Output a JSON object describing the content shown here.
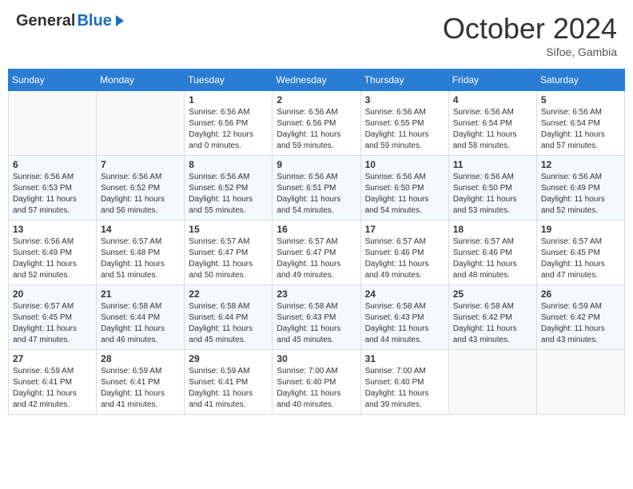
{
  "header": {
    "logo_general": "General",
    "logo_blue": "Blue",
    "month_title": "October 2024",
    "location": "Sifoe, Gambia"
  },
  "weekdays": [
    "Sunday",
    "Monday",
    "Tuesday",
    "Wednesday",
    "Thursday",
    "Friday",
    "Saturday"
  ],
  "weeks": [
    [
      {
        "day": "",
        "info": ""
      },
      {
        "day": "",
        "info": ""
      },
      {
        "day": "1",
        "sunrise": "6:56 AM",
        "sunset": "6:56 PM",
        "daylight": "12 hours and 0 minutes."
      },
      {
        "day": "2",
        "sunrise": "6:56 AM",
        "sunset": "6:56 PM",
        "daylight": "11 hours and 59 minutes."
      },
      {
        "day": "3",
        "sunrise": "6:56 AM",
        "sunset": "6:55 PM",
        "daylight": "11 hours and 59 minutes."
      },
      {
        "day": "4",
        "sunrise": "6:56 AM",
        "sunset": "6:54 PM",
        "daylight": "11 hours and 58 minutes."
      },
      {
        "day": "5",
        "sunrise": "6:56 AM",
        "sunset": "6:54 PM",
        "daylight": "11 hours and 57 minutes."
      }
    ],
    [
      {
        "day": "6",
        "sunrise": "6:56 AM",
        "sunset": "6:53 PM",
        "daylight": "11 hours and 57 minutes."
      },
      {
        "day": "7",
        "sunrise": "6:56 AM",
        "sunset": "6:52 PM",
        "daylight": "11 hours and 56 minutes."
      },
      {
        "day": "8",
        "sunrise": "6:56 AM",
        "sunset": "6:52 PM",
        "daylight": "11 hours and 55 minutes."
      },
      {
        "day": "9",
        "sunrise": "6:56 AM",
        "sunset": "6:51 PM",
        "daylight": "11 hours and 54 minutes."
      },
      {
        "day": "10",
        "sunrise": "6:56 AM",
        "sunset": "6:50 PM",
        "daylight": "11 hours and 54 minutes."
      },
      {
        "day": "11",
        "sunrise": "6:56 AM",
        "sunset": "6:50 PM",
        "daylight": "11 hours and 53 minutes."
      },
      {
        "day": "12",
        "sunrise": "6:56 AM",
        "sunset": "6:49 PM",
        "daylight": "11 hours and 52 minutes."
      }
    ],
    [
      {
        "day": "13",
        "sunrise": "6:56 AM",
        "sunset": "6:49 PM",
        "daylight": "11 hours and 52 minutes."
      },
      {
        "day": "14",
        "sunrise": "6:57 AM",
        "sunset": "6:48 PM",
        "daylight": "11 hours and 51 minutes."
      },
      {
        "day": "15",
        "sunrise": "6:57 AM",
        "sunset": "6:47 PM",
        "daylight": "11 hours and 50 minutes."
      },
      {
        "day": "16",
        "sunrise": "6:57 AM",
        "sunset": "6:47 PM",
        "daylight": "11 hours and 49 minutes."
      },
      {
        "day": "17",
        "sunrise": "6:57 AM",
        "sunset": "6:46 PM",
        "daylight": "11 hours and 49 minutes."
      },
      {
        "day": "18",
        "sunrise": "6:57 AM",
        "sunset": "6:46 PM",
        "daylight": "11 hours and 48 minutes."
      },
      {
        "day": "19",
        "sunrise": "6:57 AM",
        "sunset": "6:45 PM",
        "daylight": "11 hours and 47 minutes."
      }
    ],
    [
      {
        "day": "20",
        "sunrise": "6:57 AM",
        "sunset": "6:45 PM",
        "daylight": "11 hours and 47 minutes."
      },
      {
        "day": "21",
        "sunrise": "6:58 AM",
        "sunset": "6:44 PM",
        "daylight": "11 hours and 46 minutes."
      },
      {
        "day": "22",
        "sunrise": "6:58 AM",
        "sunset": "6:44 PM",
        "daylight": "11 hours and 45 minutes."
      },
      {
        "day": "23",
        "sunrise": "6:58 AM",
        "sunset": "6:43 PM",
        "daylight": "11 hours and 45 minutes."
      },
      {
        "day": "24",
        "sunrise": "6:58 AM",
        "sunset": "6:43 PM",
        "daylight": "11 hours and 44 minutes."
      },
      {
        "day": "25",
        "sunrise": "6:58 AM",
        "sunset": "6:42 PM",
        "daylight": "11 hours and 43 minutes."
      },
      {
        "day": "26",
        "sunrise": "6:59 AM",
        "sunset": "6:42 PM",
        "daylight": "11 hours and 43 minutes."
      }
    ],
    [
      {
        "day": "27",
        "sunrise": "6:59 AM",
        "sunset": "6:41 PM",
        "daylight": "11 hours and 42 minutes."
      },
      {
        "day": "28",
        "sunrise": "6:59 AM",
        "sunset": "6:41 PM",
        "daylight": "11 hours and 41 minutes."
      },
      {
        "day": "29",
        "sunrise": "6:59 AM",
        "sunset": "6:41 PM",
        "daylight": "11 hours and 41 minutes."
      },
      {
        "day": "30",
        "sunrise": "7:00 AM",
        "sunset": "6:40 PM",
        "daylight": "11 hours and 40 minutes."
      },
      {
        "day": "31",
        "sunrise": "7:00 AM",
        "sunset": "6:40 PM",
        "daylight": "11 hours and 39 minutes."
      },
      {
        "day": "",
        "info": ""
      },
      {
        "day": "",
        "info": ""
      }
    ]
  ]
}
